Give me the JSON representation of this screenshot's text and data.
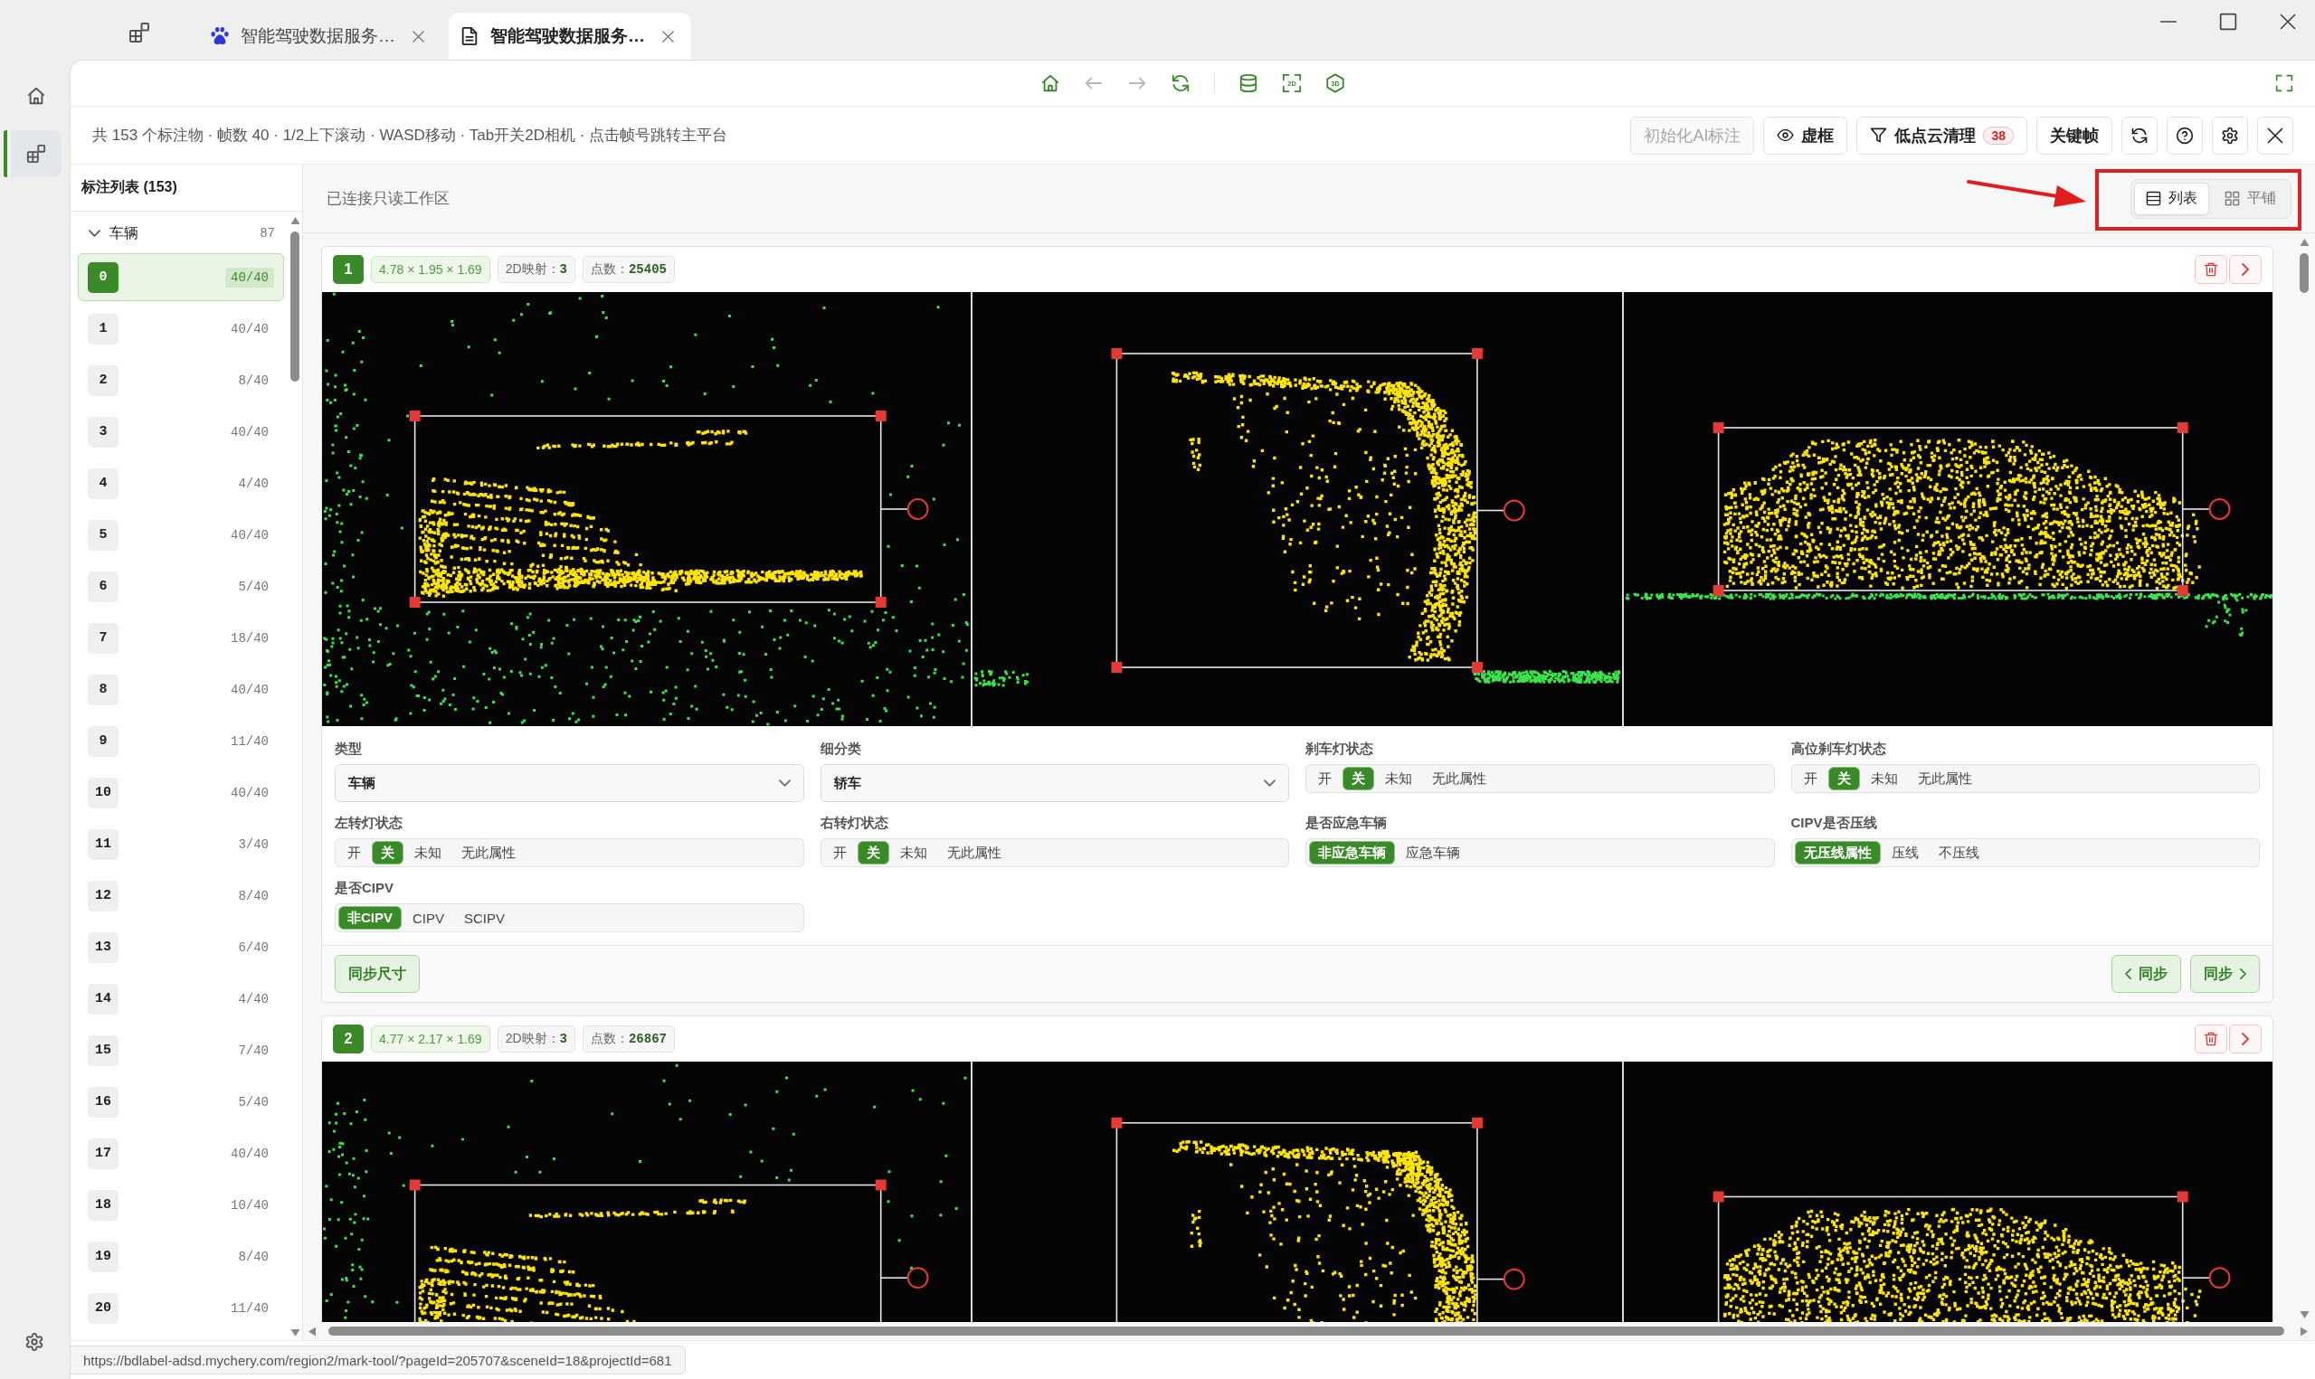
{
  "browser": {
    "tabs": [
      {
        "title": "智能驾驶数据服务…",
        "selected": false
      },
      {
        "title": "智能驾驶数据服务…",
        "selected": true
      }
    ]
  },
  "sidebar_nav": [
    {
      "selected": false
    },
    {
      "selected": true
    }
  ],
  "toolbar": {
    "icon_labels": [
      "2D",
      "3D"
    ]
  },
  "header": {
    "hint": "共 153 个标注物 · 帧数 40 · 1/2上下滚动 · WASD移动 · Tab开关2D相机 · 点击帧号跳转主平台",
    "ai_button": {
      "label": "初始化AI标注",
      "disabled": true
    },
    "ghost_box_button": {
      "label": "虚框"
    },
    "low_cloud_button": {
      "label": "低点云清理",
      "badge": "38"
    },
    "keyframe_button": {
      "label": "关键帧"
    }
  },
  "list_panel": {
    "title": "标注列表 (153)",
    "groups": [
      {
        "label": "车辆",
        "count": "87",
        "expanded": true,
        "items": [
          {
            "id": "0",
            "frames": "40/40",
            "selected": true
          },
          {
            "id": "1",
            "frames": "40/40",
            "selected": false
          },
          {
            "id": "2",
            "frames": "8/40",
            "selected": false
          },
          {
            "id": "3",
            "frames": "40/40",
            "selected": false
          },
          {
            "id": "4",
            "frames": "4/40",
            "selected": false
          },
          {
            "id": "5",
            "frames": "40/40",
            "selected": false
          },
          {
            "id": "6",
            "frames": "5/40",
            "selected": false
          },
          {
            "id": "7",
            "frames": "18/40",
            "selected": false
          },
          {
            "id": "8",
            "frames": "40/40",
            "selected": false
          },
          {
            "id": "9",
            "frames": "11/40",
            "selected": false
          },
          {
            "id": "10",
            "frames": "40/40",
            "selected": false
          },
          {
            "id": "11",
            "frames": "3/40",
            "selected": false
          },
          {
            "id": "12",
            "frames": "8/40",
            "selected": false
          },
          {
            "id": "13",
            "frames": "6/40",
            "selected": false
          },
          {
            "id": "14",
            "frames": "4/40",
            "selected": false
          },
          {
            "id": "15",
            "frames": "7/40",
            "selected": false
          },
          {
            "id": "16",
            "frames": "5/40",
            "selected": false
          },
          {
            "id": "17",
            "frames": "40/40",
            "selected": false
          },
          {
            "id": "18",
            "frames": "10/40",
            "selected": false
          },
          {
            "id": "19",
            "frames": "8/40",
            "selected": false
          },
          {
            "id": "20",
            "frames": "11/40",
            "selected": false
          }
        ]
      }
    ]
  },
  "workspace": {
    "status": "已连接只读工作区",
    "view_modes": [
      {
        "label": "列表",
        "selected": true
      },
      {
        "label": "平铺",
        "selected": false
      }
    ]
  },
  "cards": [
    {
      "index": "1",
      "size": "4.78 × 1.95 × 1.69",
      "mapping": "2D映射：**3**",
      "points": "点数：**25405**",
      "attributes": [
        {
          "label": "类型",
          "kind": "select",
          "value": "车辆"
        },
        {
          "label": "细分类",
          "kind": "select",
          "value": "轿车"
        },
        {
          "label": "刹车灯状态",
          "kind": "segmented",
          "options": [
            {
              "label": "开",
              "selected": false
            },
            {
              "label": "关",
              "selected": true
            },
            {
              "label": "未知",
              "selected": false
            },
            {
              "label": "无此属性",
              "selected": false
            }
          ]
        },
        {
          "label": "高位刹车灯状态",
          "kind": "segmented",
          "options": [
            {
              "label": "开",
              "selected": false
            },
            {
              "label": "关",
              "selected": true
            },
            {
              "label": "未知",
              "selected": false
            },
            {
              "label": "无此属性",
              "selected": false
            }
          ]
        },
        {
          "label": "左转灯状态",
          "kind": "segmented",
          "options": [
            {
              "label": "开",
              "selected": false
            },
            {
              "label": "关",
              "selected": true
            },
            {
              "label": "未知",
              "selected": false
            },
            {
              "label": "无此属性",
              "selected": false
            }
          ]
        },
        {
          "label": "右转灯状态",
          "kind": "segmented",
          "options": [
            {
              "label": "开",
              "selected": false
            },
            {
              "label": "关",
              "selected": true
            },
            {
              "label": "未知",
              "selected": false
            },
            {
              "label": "无此属性",
              "selected": false
            }
          ]
        },
        {
          "label": "是否应急车辆",
          "kind": "segmented",
          "options": [
            {
              "label": "非应急车辆",
              "selected": true
            },
            {
              "label": "应急车辆",
              "selected": false
            }
          ]
        },
        {
          "label": "CIPV是否压线",
          "kind": "segmented",
          "options": [
            {
              "label": "无压线属性",
              "selected": true
            },
            {
              "label": "压线",
              "selected": false
            },
            {
              "label": "不压线",
              "selected": false
            }
          ]
        },
        {
          "label": "是否CIPV",
          "kind": "segmented",
          "options": [
            {
              "label": "非CIPV",
              "selected": true
            },
            {
              "label": "CIPV",
              "selected": false
            },
            {
              "label": "SCIPV",
              "selected": false
            }
          ]
        }
      ],
      "footer": {
        "sync_size_button": {
          "label": "同步尺寸"
        },
        "sync_prev_button": {
          "label": "同步"
        },
        "sync_next_button": {
          "label": "同步"
        }
      }
    },
    {
      "index": "2",
      "size": "4.77 × 2.17 × 1.69",
      "mapping": "2D映射：**3**",
      "points": "点数：**26867**"
    }
  ],
  "status_url": "https://bdlabel-adsd.mychery.com/region2/mark-tool/?pageId=205707&sceneId=18&projectId=681"
}
